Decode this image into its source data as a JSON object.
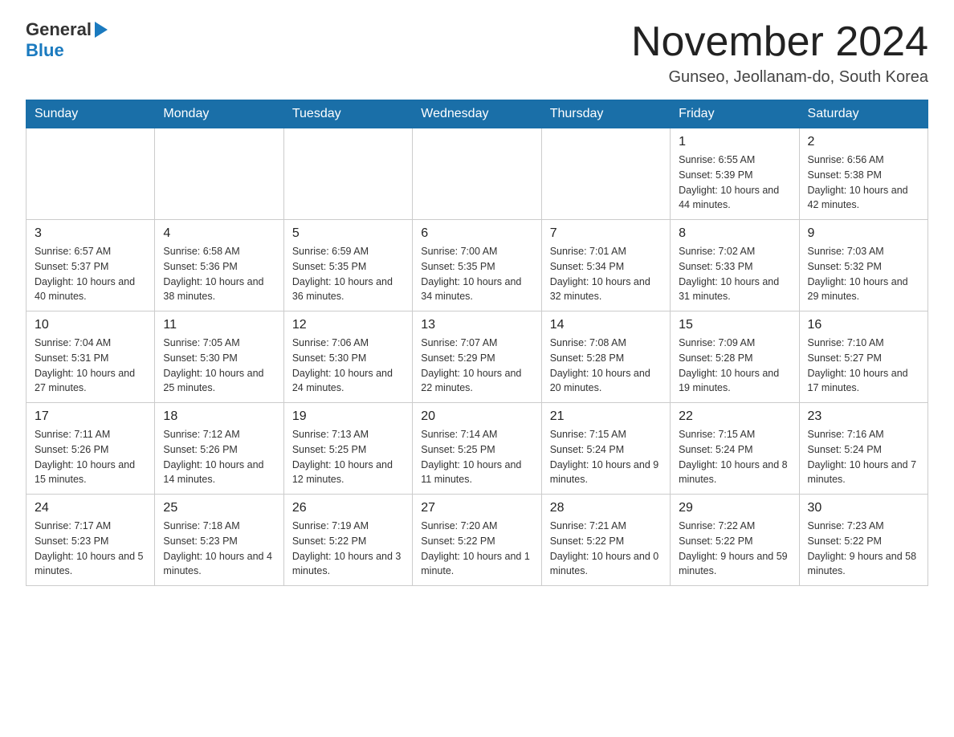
{
  "logo": {
    "general": "General",
    "blue": "Blue"
  },
  "header": {
    "title": "November 2024",
    "location": "Gunseo, Jeollanam-do, South Korea"
  },
  "days_of_week": [
    "Sunday",
    "Monday",
    "Tuesday",
    "Wednesday",
    "Thursday",
    "Friday",
    "Saturday"
  ],
  "weeks": [
    {
      "days": [
        {
          "num": "",
          "sunrise": "",
          "sunset": "",
          "daylight": ""
        },
        {
          "num": "",
          "sunrise": "",
          "sunset": "",
          "daylight": ""
        },
        {
          "num": "",
          "sunrise": "",
          "sunset": "",
          "daylight": ""
        },
        {
          "num": "",
          "sunrise": "",
          "sunset": "",
          "daylight": ""
        },
        {
          "num": "",
          "sunrise": "",
          "sunset": "",
          "daylight": ""
        },
        {
          "num": "1",
          "sunrise": "Sunrise: 6:55 AM",
          "sunset": "Sunset: 5:39 PM",
          "daylight": "Daylight: 10 hours and 44 minutes."
        },
        {
          "num": "2",
          "sunrise": "Sunrise: 6:56 AM",
          "sunset": "Sunset: 5:38 PM",
          "daylight": "Daylight: 10 hours and 42 minutes."
        }
      ]
    },
    {
      "days": [
        {
          "num": "3",
          "sunrise": "Sunrise: 6:57 AM",
          "sunset": "Sunset: 5:37 PM",
          "daylight": "Daylight: 10 hours and 40 minutes."
        },
        {
          "num": "4",
          "sunrise": "Sunrise: 6:58 AM",
          "sunset": "Sunset: 5:36 PM",
          "daylight": "Daylight: 10 hours and 38 minutes."
        },
        {
          "num": "5",
          "sunrise": "Sunrise: 6:59 AM",
          "sunset": "Sunset: 5:35 PM",
          "daylight": "Daylight: 10 hours and 36 minutes."
        },
        {
          "num": "6",
          "sunrise": "Sunrise: 7:00 AM",
          "sunset": "Sunset: 5:35 PM",
          "daylight": "Daylight: 10 hours and 34 minutes."
        },
        {
          "num": "7",
          "sunrise": "Sunrise: 7:01 AM",
          "sunset": "Sunset: 5:34 PM",
          "daylight": "Daylight: 10 hours and 32 minutes."
        },
        {
          "num": "8",
          "sunrise": "Sunrise: 7:02 AM",
          "sunset": "Sunset: 5:33 PM",
          "daylight": "Daylight: 10 hours and 31 minutes."
        },
        {
          "num": "9",
          "sunrise": "Sunrise: 7:03 AM",
          "sunset": "Sunset: 5:32 PM",
          "daylight": "Daylight: 10 hours and 29 minutes."
        }
      ]
    },
    {
      "days": [
        {
          "num": "10",
          "sunrise": "Sunrise: 7:04 AM",
          "sunset": "Sunset: 5:31 PM",
          "daylight": "Daylight: 10 hours and 27 minutes."
        },
        {
          "num": "11",
          "sunrise": "Sunrise: 7:05 AM",
          "sunset": "Sunset: 5:30 PM",
          "daylight": "Daylight: 10 hours and 25 minutes."
        },
        {
          "num": "12",
          "sunrise": "Sunrise: 7:06 AM",
          "sunset": "Sunset: 5:30 PM",
          "daylight": "Daylight: 10 hours and 24 minutes."
        },
        {
          "num": "13",
          "sunrise": "Sunrise: 7:07 AM",
          "sunset": "Sunset: 5:29 PM",
          "daylight": "Daylight: 10 hours and 22 minutes."
        },
        {
          "num": "14",
          "sunrise": "Sunrise: 7:08 AM",
          "sunset": "Sunset: 5:28 PM",
          "daylight": "Daylight: 10 hours and 20 minutes."
        },
        {
          "num": "15",
          "sunrise": "Sunrise: 7:09 AM",
          "sunset": "Sunset: 5:28 PM",
          "daylight": "Daylight: 10 hours and 19 minutes."
        },
        {
          "num": "16",
          "sunrise": "Sunrise: 7:10 AM",
          "sunset": "Sunset: 5:27 PM",
          "daylight": "Daylight: 10 hours and 17 minutes."
        }
      ]
    },
    {
      "days": [
        {
          "num": "17",
          "sunrise": "Sunrise: 7:11 AM",
          "sunset": "Sunset: 5:26 PM",
          "daylight": "Daylight: 10 hours and 15 minutes."
        },
        {
          "num": "18",
          "sunrise": "Sunrise: 7:12 AM",
          "sunset": "Sunset: 5:26 PM",
          "daylight": "Daylight: 10 hours and 14 minutes."
        },
        {
          "num": "19",
          "sunrise": "Sunrise: 7:13 AM",
          "sunset": "Sunset: 5:25 PM",
          "daylight": "Daylight: 10 hours and 12 minutes."
        },
        {
          "num": "20",
          "sunrise": "Sunrise: 7:14 AM",
          "sunset": "Sunset: 5:25 PM",
          "daylight": "Daylight: 10 hours and 11 minutes."
        },
        {
          "num": "21",
          "sunrise": "Sunrise: 7:15 AM",
          "sunset": "Sunset: 5:24 PM",
          "daylight": "Daylight: 10 hours and 9 minutes."
        },
        {
          "num": "22",
          "sunrise": "Sunrise: 7:15 AM",
          "sunset": "Sunset: 5:24 PM",
          "daylight": "Daylight: 10 hours and 8 minutes."
        },
        {
          "num": "23",
          "sunrise": "Sunrise: 7:16 AM",
          "sunset": "Sunset: 5:24 PM",
          "daylight": "Daylight: 10 hours and 7 minutes."
        }
      ]
    },
    {
      "days": [
        {
          "num": "24",
          "sunrise": "Sunrise: 7:17 AM",
          "sunset": "Sunset: 5:23 PM",
          "daylight": "Daylight: 10 hours and 5 minutes."
        },
        {
          "num": "25",
          "sunrise": "Sunrise: 7:18 AM",
          "sunset": "Sunset: 5:23 PM",
          "daylight": "Daylight: 10 hours and 4 minutes."
        },
        {
          "num": "26",
          "sunrise": "Sunrise: 7:19 AM",
          "sunset": "Sunset: 5:22 PM",
          "daylight": "Daylight: 10 hours and 3 minutes."
        },
        {
          "num": "27",
          "sunrise": "Sunrise: 7:20 AM",
          "sunset": "Sunset: 5:22 PM",
          "daylight": "Daylight: 10 hours and 1 minute."
        },
        {
          "num": "28",
          "sunrise": "Sunrise: 7:21 AM",
          "sunset": "Sunset: 5:22 PM",
          "daylight": "Daylight: 10 hours and 0 minutes."
        },
        {
          "num": "29",
          "sunrise": "Sunrise: 7:22 AM",
          "sunset": "Sunset: 5:22 PM",
          "daylight": "Daylight: 9 hours and 59 minutes."
        },
        {
          "num": "30",
          "sunrise": "Sunrise: 7:23 AM",
          "sunset": "Sunset: 5:22 PM",
          "daylight": "Daylight: 9 hours and 58 minutes."
        }
      ]
    }
  ]
}
